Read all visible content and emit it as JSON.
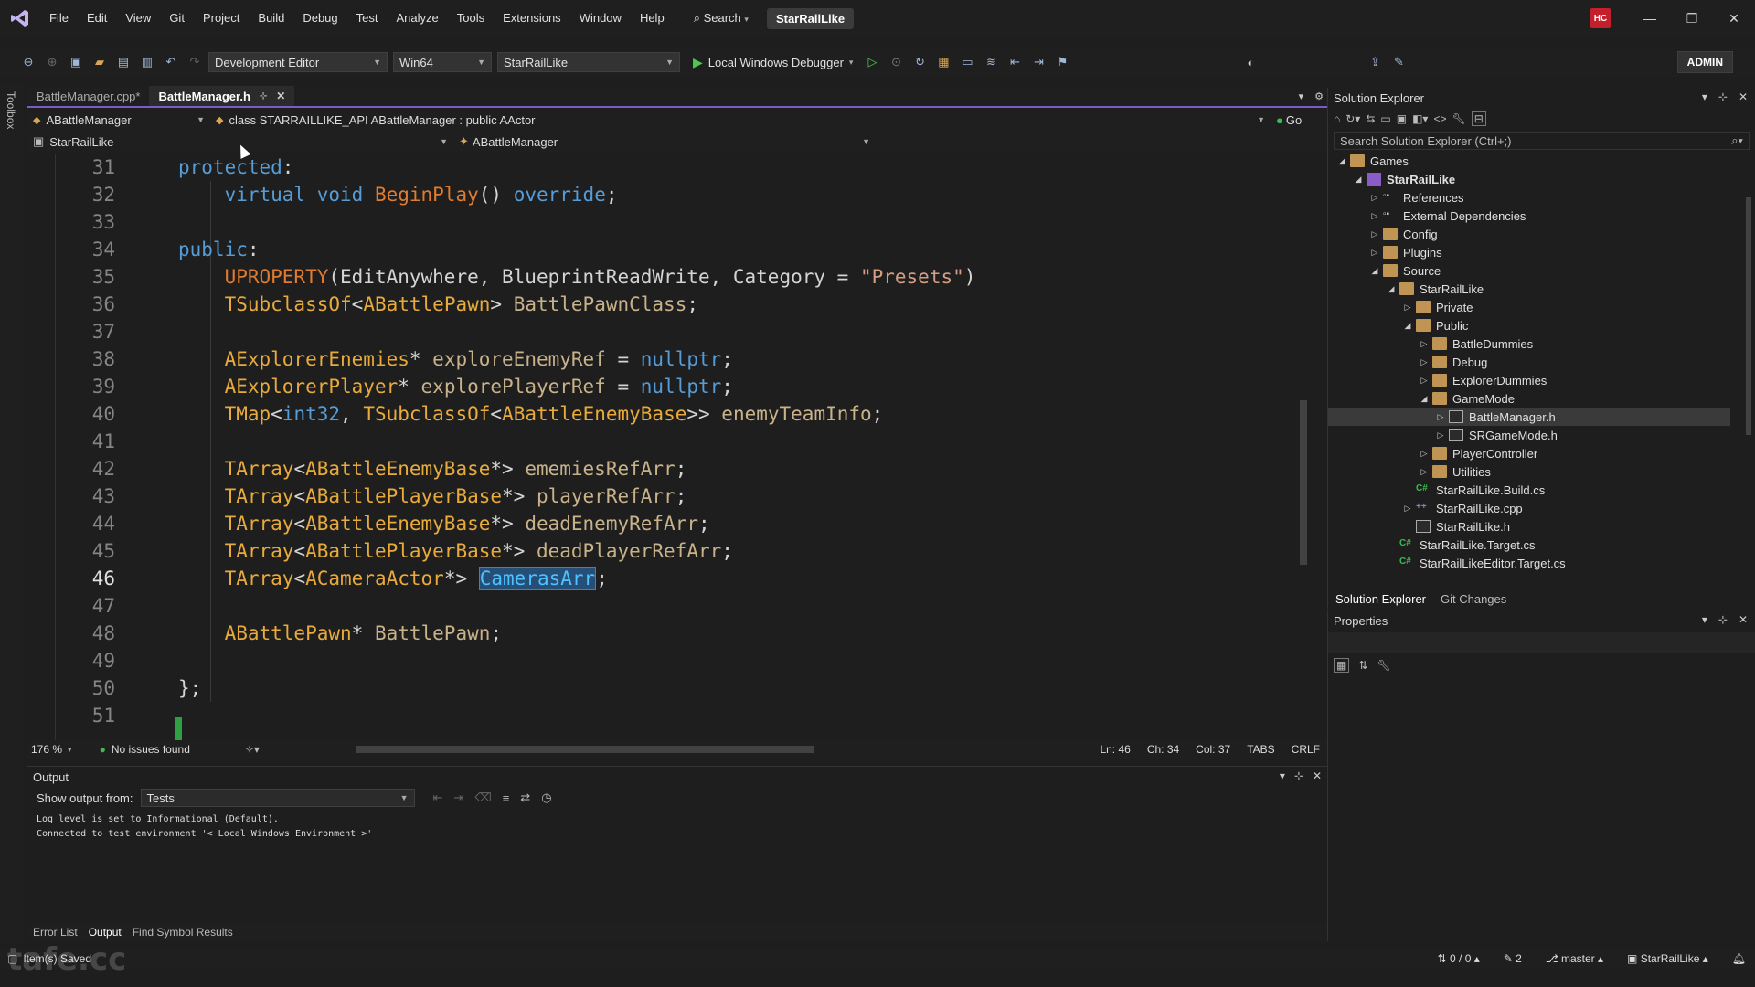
{
  "menubar": {
    "items": [
      "File",
      "Edit",
      "View",
      "Git",
      "Project",
      "Build",
      "Debug",
      "Test",
      "Analyze",
      "Tools",
      "Extensions",
      "Window",
      "Help"
    ],
    "search_label": "Search",
    "project_name": "StarRailLike",
    "avatar_initials": "HC"
  },
  "toolbar": {
    "config_combo": "Development Editor",
    "platform_combo": "Win64",
    "startup_combo": "StarRailLike",
    "run_label": "Local Windows Debugger",
    "admin_label": "ADMIN"
  },
  "toolbox_label": "Toolbox",
  "editor_tabs": [
    {
      "label": "BattleManager.cpp*",
      "active": false
    },
    {
      "label": "BattleManager.h",
      "active": true
    }
  ],
  "navbar1": {
    "left": "ABattleManager",
    "middle": "class STARRAILLIKE_API ABattleManager : public AActor",
    "go": "Go"
  },
  "navbar2": {
    "left": "StarRailLike",
    "middle": "ABattleManager"
  },
  "code": {
    "lines": [
      {
        "n": "31",
        "parts": [
          [
            "kw-blue",
            "protected"
          ],
          [
            "punc",
            ":"
          ]
        ]
      },
      {
        "n": "32",
        "parts": [
          [
            "punc",
            "    "
          ],
          [
            "kw-blue",
            "virtual void "
          ],
          [
            "fn",
            "BeginPlay"
          ],
          [
            "punc",
            "() "
          ],
          [
            "kw-blue",
            "override"
          ],
          [
            "punc",
            ";"
          ]
        ]
      },
      {
        "n": "33",
        "parts": []
      },
      {
        "n": "34",
        "parts": [
          [
            "kw-blue",
            "public"
          ],
          [
            "punc",
            ":"
          ]
        ]
      },
      {
        "n": "35",
        "parts": [
          [
            "punc",
            "    "
          ],
          [
            "kw-macro",
            "UPROPERTY"
          ],
          [
            "punc",
            "(EditAnywhere, BlueprintReadWrite, Category = "
          ],
          [
            "str",
            "\"Presets\""
          ],
          [
            "punc",
            ")"
          ]
        ]
      },
      {
        "n": "36",
        "parts": [
          [
            "punc",
            "    "
          ],
          [
            "type",
            "TSubclassOf"
          ],
          [
            "punc",
            "<"
          ],
          [
            "type",
            "ABattlePawn"
          ],
          [
            "punc",
            "> "
          ],
          [
            "var",
            "BattlePawnClass"
          ],
          [
            "punc",
            ";"
          ]
        ]
      },
      {
        "n": "37",
        "parts": []
      },
      {
        "n": "38",
        "parts": [
          [
            "punc",
            "    "
          ],
          [
            "type",
            "AExplorerEnemies"
          ],
          [
            "punc",
            "* "
          ],
          [
            "var",
            "exploreEnemyRef"
          ],
          [
            "punc",
            " = "
          ],
          [
            "kw-blue",
            "nullptr"
          ],
          [
            "punc",
            ";"
          ]
        ]
      },
      {
        "n": "39",
        "parts": [
          [
            "punc",
            "    "
          ],
          [
            "type",
            "AExplorerPlayer"
          ],
          [
            "punc",
            "* "
          ],
          [
            "var",
            "explorePlayerRef"
          ],
          [
            "punc",
            " = "
          ],
          [
            "kw-blue",
            "nullptr"
          ],
          [
            "punc",
            ";"
          ]
        ]
      },
      {
        "n": "40",
        "parts": [
          [
            "punc",
            "    "
          ],
          [
            "type",
            "TMap"
          ],
          [
            "punc",
            "<"
          ],
          [
            "kw-blue",
            "int32"
          ],
          [
            "punc",
            ", "
          ],
          [
            "type",
            "TSubclassOf"
          ],
          [
            "punc",
            "<"
          ],
          [
            "type",
            "ABattleEnemyBase"
          ],
          [
            "punc",
            ">> "
          ],
          [
            "var",
            "enemyTeamInfo"
          ],
          [
            "punc",
            ";"
          ]
        ]
      },
      {
        "n": "41",
        "parts": []
      },
      {
        "n": "42",
        "parts": [
          [
            "punc",
            "    "
          ],
          [
            "type",
            "TArray"
          ],
          [
            "punc",
            "<"
          ],
          [
            "type",
            "ABattleEnemyBase"
          ],
          [
            "punc",
            "*> "
          ],
          [
            "var",
            "ememiesRefArr"
          ],
          [
            "punc",
            ";"
          ]
        ]
      },
      {
        "n": "43",
        "parts": [
          [
            "punc",
            "    "
          ],
          [
            "type",
            "TArray"
          ],
          [
            "punc",
            "<"
          ],
          [
            "type",
            "ABattlePlayerBase"
          ],
          [
            "punc",
            "*> "
          ],
          [
            "var",
            "playerRefArr"
          ],
          [
            "punc",
            ";"
          ]
        ]
      },
      {
        "n": "44",
        "parts": [
          [
            "punc",
            "    "
          ],
          [
            "type",
            "TArray"
          ],
          [
            "punc",
            "<"
          ],
          [
            "type",
            "ABattleEnemyBase"
          ],
          [
            "punc",
            "*> "
          ],
          [
            "var",
            "deadEnemyRefArr"
          ],
          [
            "punc",
            ";"
          ]
        ]
      },
      {
        "n": "45",
        "parts": [
          [
            "punc",
            "    "
          ],
          [
            "type",
            "TArray"
          ],
          [
            "punc",
            "<"
          ],
          [
            "type",
            "ABattlePlayerBase"
          ],
          [
            "punc",
            "*> "
          ],
          [
            "var",
            "deadPlayerRefArr"
          ],
          [
            "punc",
            ";"
          ]
        ]
      },
      {
        "n": "46",
        "parts": [
          [
            "punc",
            "    "
          ],
          [
            "type",
            "TArray"
          ],
          [
            "punc",
            "<"
          ],
          [
            "type",
            "ACameraActor"
          ],
          [
            "punc",
            "*> "
          ],
          [
            "hl",
            "CamerasArr"
          ],
          [
            "punc",
            ";"
          ]
        ]
      },
      {
        "n": "47",
        "parts": []
      },
      {
        "n": "48",
        "parts": [
          [
            "punc",
            "    "
          ],
          [
            "type",
            "ABattlePawn"
          ],
          [
            "punc",
            "* "
          ],
          [
            "var",
            "BattlePawn"
          ],
          [
            "punc",
            ";"
          ]
        ]
      },
      {
        "n": "49",
        "parts": []
      },
      {
        "n": "50",
        "parts": [
          [
            "punc",
            "};"
          ]
        ]
      },
      {
        "n": "51",
        "parts": []
      }
    ],
    "current_line": "46"
  },
  "editor_status": {
    "zoom": "176 %",
    "issues": "No issues found",
    "ln": "Ln: 46",
    "ch": "Ch: 34",
    "col": "Col: 37",
    "indent": "TABS",
    "eol": "CRLF"
  },
  "output": {
    "title": "Output",
    "show_from_label": "Show output from:",
    "show_from_value": "Tests",
    "log": [
      "Log level is set to Informational (Default).",
      "Connected to test environment '< Local Windows Environment >'"
    ]
  },
  "bottom_tabs": [
    "Error List",
    "Output",
    "Find Symbol Results"
  ],
  "statusbar": {
    "left": "Item(s) Saved",
    "changes": "0 / 0",
    "edits": "2",
    "branch": "master",
    "repo": "StarRailLike"
  },
  "solution_explorer": {
    "title": "Solution Explorer",
    "search_placeholder": "Search Solution Explorer (Ctrl+;)",
    "tree": [
      {
        "label": "Games",
        "depth": 0,
        "arrow": "◢",
        "icon": "folder",
        "bold": false,
        "selected": false
      },
      {
        "label": "StarRailLike",
        "depth": 1,
        "arrow": "◢",
        "icon": "project",
        "bold": true,
        "selected": false
      },
      {
        "label": "References",
        "depth": 2,
        "arrow": "▷",
        "icon": "ref",
        "bold": false,
        "selected": false
      },
      {
        "label": "External Dependencies",
        "depth": 2,
        "arrow": "▷",
        "icon": "ref",
        "bold": false,
        "selected": false
      },
      {
        "label": "Config",
        "depth": 2,
        "arrow": "▷",
        "icon": "folder",
        "bold": false,
        "selected": false
      },
      {
        "label": "Plugins",
        "depth": 2,
        "arrow": "▷",
        "icon": "folder",
        "bold": false,
        "selected": false
      },
      {
        "label": "Source",
        "depth": 2,
        "arrow": "◢",
        "icon": "folder",
        "bold": false,
        "selected": false
      },
      {
        "label": "StarRailLike",
        "depth": 3,
        "arrow": "◢",
        "icon": "folder",
        "bold": false,
        "selected": false
      },
      {
        "label": "Private",
        "depth": 4,
        "arrow": "▷",
        "icon": "folder",
        "bold": false,
        "selected": false
      },
      {
        "label": "Public",
        "depth": 4,
        "arrow": "◢",
        "icon": "folder",
        "bold": false,
        "selected": false
      },
      {
        "label": "BattleDummies",
        "depth": 5,
        "arrow": "▷",
        "icon": "folder",
        "bold": false,
        "selected": false
      },
      {
        "label": "Debug",
        "depth": 5,
        "arrow": "▷",
        "icon": "folder",
        "bold": false,
        "selected": false
      },
      {
        "label": "ExplorerDummies",
        "depth": 5,
        "arrow": "▷",
        "icon": "folder",
        "bold": false,
        "selected": false
      },
      {
        "label": "GameMode",
        "depth": 5,
        "arrow": "◢",
        "icon": "folder",
        "bold": false,
        "selected": false
      },
      {
        "label": "BattleManager.h",
        "depth": 6,
        "arrow": "▷",
        "icon": "file-h",
        "bold": false,
        "selected": true
      },
      {
        "label": "SRGameMode.h",
        "depth": 6,
        "arrow": "▷",
        "icon": "file-h",
        "bold": false,
        "selected": false
      },
      {
        "label": "PlayerController",
        "depth": 5,
        "arrow": "▷",
        "icon": "folder",
        "bold": false,
        "selected": false
      },
      {
        "label": "Utilities",
        "depth": 5,
        "arrow": "▷",
        "icon": "folder",
        "bold": false,
        "selected": false
      },
      {
        "label": "StarRailLike.Build.cs",
        "depth": 4,
        "arrow": "",
        "icon": "file-cs",
        "bold": false,
        "selected": false
      },
      {
        "label": "StarRailLike.cpp",
        "depth": 4,
        "arrow": "▷",
        "icon": "file-cpp",
        "bold": false,
        "selected": false
      },
      {
        "label": "StarRailLike.h",
        "depth": 4,
        "arrow": "",
        "icon": "file-h",
        "bold": false,
        "selected": false
      },
      {
        "label": "StarRailLike.Target.cs",
        "depth": 3,
        "arrow": "",
        "icon": "file-cs",
        "bold": false,
        "selected": false
      },
      {
        "label": "StarRailLikeEditor.Target.cs",
        "depth": 3,
        "arrow": "",
        "icon": "file-cs",
        "bold": false,
        "selected": false
      }
    ],
    "tabs": [
      "Solution Explorer",
      "Git Changes"
    ]
  },
  "properties": {
    "title": "Properties"
  },
  "watermark": "tafe.cc",
  "colors": {
    "accent": "#7a5cc7",
    "selection": "#264f78",
    "keyword": "#569cd6",
    "type": "#e8ab3b",
    "variable": "#c8b28a",
    "string": "#d69d85",
    "ok": "#3fb950"
  }
}
